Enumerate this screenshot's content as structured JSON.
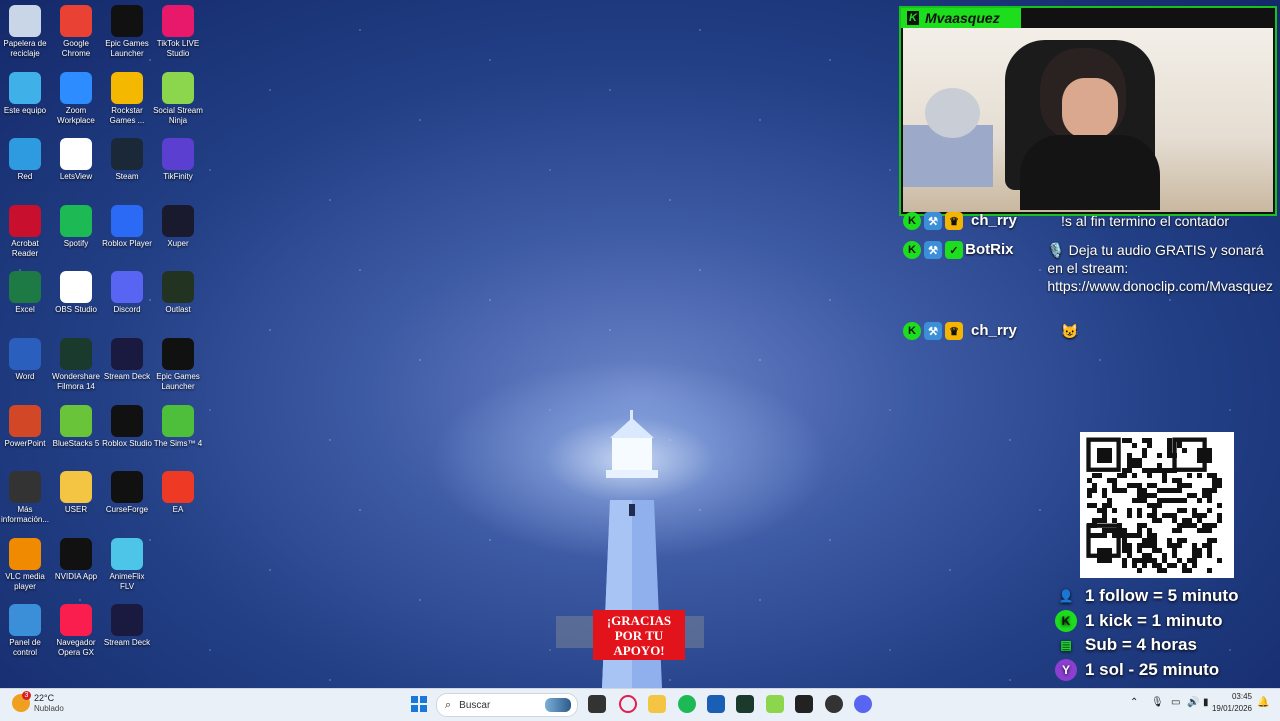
{
  "desktop_icons": [
    {
      "label": "Papelera de reciclaje",
      "icon": "recycle-bin-icon",
      "color": "#c9d6e8"
    },
    {
      "label": "Google Chrome",
      "icon": "chrome-icon",
      "color": "#e94235"
    },
    {
      "label": "Epic Games Launcher",
      "icon": "epic-games-icon",
      "color": "#111111"
    },
    {
      "label": "TikTok LIVE Studio",
      "icon": "tiktok-icon",
      "color": "#e8186a"
    },
    {
      "label": "Este equipo",
      "icon": "computer-icon",
      "color": "#3fb1e8"
    },
    {
      "label": "Zoom Workplace",
      "icon": "zoom-icon",
      "color": "#2d8cff"
    },
    {
      "label": "Rockstar Games ...",
      "icon": "rockstar-icon",
      "color": "#f5b800"
    },
    {
      "label": "Social Stream Ninja",
      "icon": "ninja-icon",
      "color": "#8bd64c"
    },
    {
      "label": "Red",
      "icon": "network-icon",
      "color": "#2e9ae0"
    },
    {
      "label": "LetsView",
      "icon": "letsview-icon",
      "color": "#ffffff"
    },
    {
      "label": "Steam",
      "icon": "steam-icon",
      "color": "#1b2838"
    },
    {
      "label": "TikFinity",
      "icon": "tikfinity-icon",
      "color": "#5a3fd0"
    },
    {
      "label": "Acrobat Reader",
      "icon": "acrobat-icon",
      "color": "#c8102e"
    },
    {
      "label": "Spotify",
      "icon": "spotify-icon",
      "color": "#1db954"
    },
    {
      "label": "Roblox Player",
      "icon": "roblox-icon",
      "color": "#2b6af5"
    },
    {
      "label": "Xuper",
      "icon": "xuper-icon",
      "color": "#1a1a2e"
    },
    {
      "label": "Excel",
      "icon": "excel-icon",
      "color": "#1d7a45"
    },
    {
      "label": "OBS Studio",
      "icon": "file-icon",
      "color": "#ffffff"
    },
    {
      "label": "Discord",
      "icon": "discord-icon",
      "color": "#5865f2"
    },
    {
      "label": "Outlast",
      "icon": "outlast-icon",
      "color": "#223322"
    },
    {
      "label": "Word",
      "icon": "word-icon",
      "color": "#2b5fbd"
    },
    {
      "label": "Wondershare Filmora 14",
      "icon": "filmora-icon",
      "color": "#1a3a2e"
    },
    {
      "label": "Stream Deck",
      "icon": "stream-deck-icon",
      "color": "#1a1a40"
    },
    {
      "label": "Epic Games Launcher",
      "icon": "epic-games-icon",
      "color": "#111111"
    },
    {
      "label": "PowerPoint",
      "icon": "powerpoint-icon",
      "color": "#d24726"
    },
    {
      "label": "BlueStacks 5",
      "icon": "bluestacks-icon",
      "color": "#6ac43a"
    },
    {
      "label": "Roblox Studio",
      "icon": "roblox-studio-icon",
      "color": "#111111"
    },
    {
      "label": "The Sims™ 4",
      "icon": "sims-icon",
      "color": "#4dbf3a"
    },
    {
      "label": "Más información...",
      "icon": "info-icon",
      "color": "#333333"
    },
    {
      "label": "USER",
      "icon": "folder-icon",
      "color": "#f4c542"
    },
    {
      "label": "CurseForge",
      "icon": "curseforge-icon",
      "color": "#111111"
    },
    {
      "label": "EA",
      "icon": "ea-icon",
      "color": "#ee3a24"
    },
    {
      "label": "VLC media player",
      "icon": "vlc-icon",
      "color": "#f08a00"
    },
    {
      "label": "NVIDIA App",
      "icon": "nvidia-icon",
      "color": "#111111"
    },
    {
      "label": "AnimeFlix FLV",
      "icon": "animeflix-icon",
      "color": "#4cc5e8"
    },
    {
      "label": "",
      "icon": "blank-icon",
      "color": "transparent"
    },
    {
      "label": "Panel de control",
      "icon": "control-panel-icon",
      "color": "#3a8fd8"
    },
    {
      "label": "Navegador Opera GX",
      "icon": "opera-gx-icon",
      "color": "#fa1e4e"
    },
    {
      "label": "Stream Deck",
      "icon": "stream-deck-icon",
      "color": "#1a1a40"
    }
  ],
  "webcam": {
    "streamer_name": "Mvaasquez",
    "brand_letter": "K",
    "accent": "#1dde1c"
  },
  "chat": [
    {
      "user": "ch_rry",
      "message": "!s al fin termino el contador"
    },
    {
      "user": "BotRix",
      "message": "🎙️ Deja tu audio GRATIS y sonará en el stream: https://www.donoclip.com/Mvasquez"
    },
    {
      "user": "ch_rry",
      "message": "😺"
    }
  ],
  "rules": [
    {
      "icon": "follow-icon",
      "glyph": "👤",
      "text": "1 follow = 5 minuto"
    },
    {
      "icon": "kick-icon",
      "glyph": "K",
      "text": "1 kick = 1 minuto"
    },
    {
      "icon": "sub-icon",
      "glyph": "▤",
      "text": "Sub = 4 horas"
    },
    {
      "icon": "sol-icon",
      "glyph": "Y",
      "text": "1 sol - 25 minuto"
    }
  ],
  "alert": {
    "text": "¡GRACIAS POR TU APOYO!"
  },
  "taskbar": {
    "weather_temp": "22°C",
    "weather_desc": "Nublado",
    "weather_badge": "3",
    "search_placeholder": "Buscar",
    "time": "03:45",
    "date": "19/01/2026"
  }
}
